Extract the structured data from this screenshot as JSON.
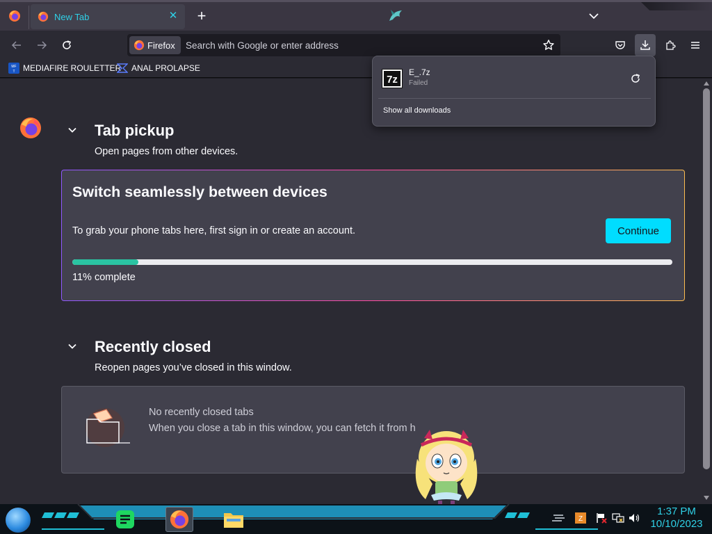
{
  "tabs": [
    {
      "title": "New Tab"
    }
  ],
  "urlbar": {
    "identity_label": "Firefox",
    "placeholder": "Search with Google or enter address"
  },
  "bookmarks": [
    {
      "label": "MEDIAFIRE ROULETTER",
      "icon": "mediafire-icon"
    },
    {
      "label": "ANAL PROLAPSE",
      "icon": "bookmark-icon"
    }
  ],
  "tab_pickup": {
    "title": "Tab pickup",
    "subtitle": "Open pages from other devices.",
    "card_title": "Switch seamlessly between devices",
    "card_text": "To grab your phone tabs here, first sign in or create an account.",
    "continue_label": "Continue",
    "progress_percent": 11,
    "progress_label": "11% complete"
  },
  "recently_closed": {
    "title": "Recently closed",
    "subtitle": "Reopen pages you’ve closed in this window.",
    "empty_title": "No recently closed tabs",
    "empty_text": "When you close a tab in this window, you can fetch it from h"
  },
  "downloads": {
    "items": [
      {
        "name": "E_.7z",
        "status": "Failed",
        "icon": "7z-icon"
      }
    ],
    "show_all_label": "Show all downloads"
  },
  "taskbar": {
    "time": "1:37 PM",
    "date": "10/10/2023"
  },
  "colors": {
    "accent": "#00ddff",
    "progress": "#2ac3a2",
    "clock": "#2fd0e6"
  }
}
